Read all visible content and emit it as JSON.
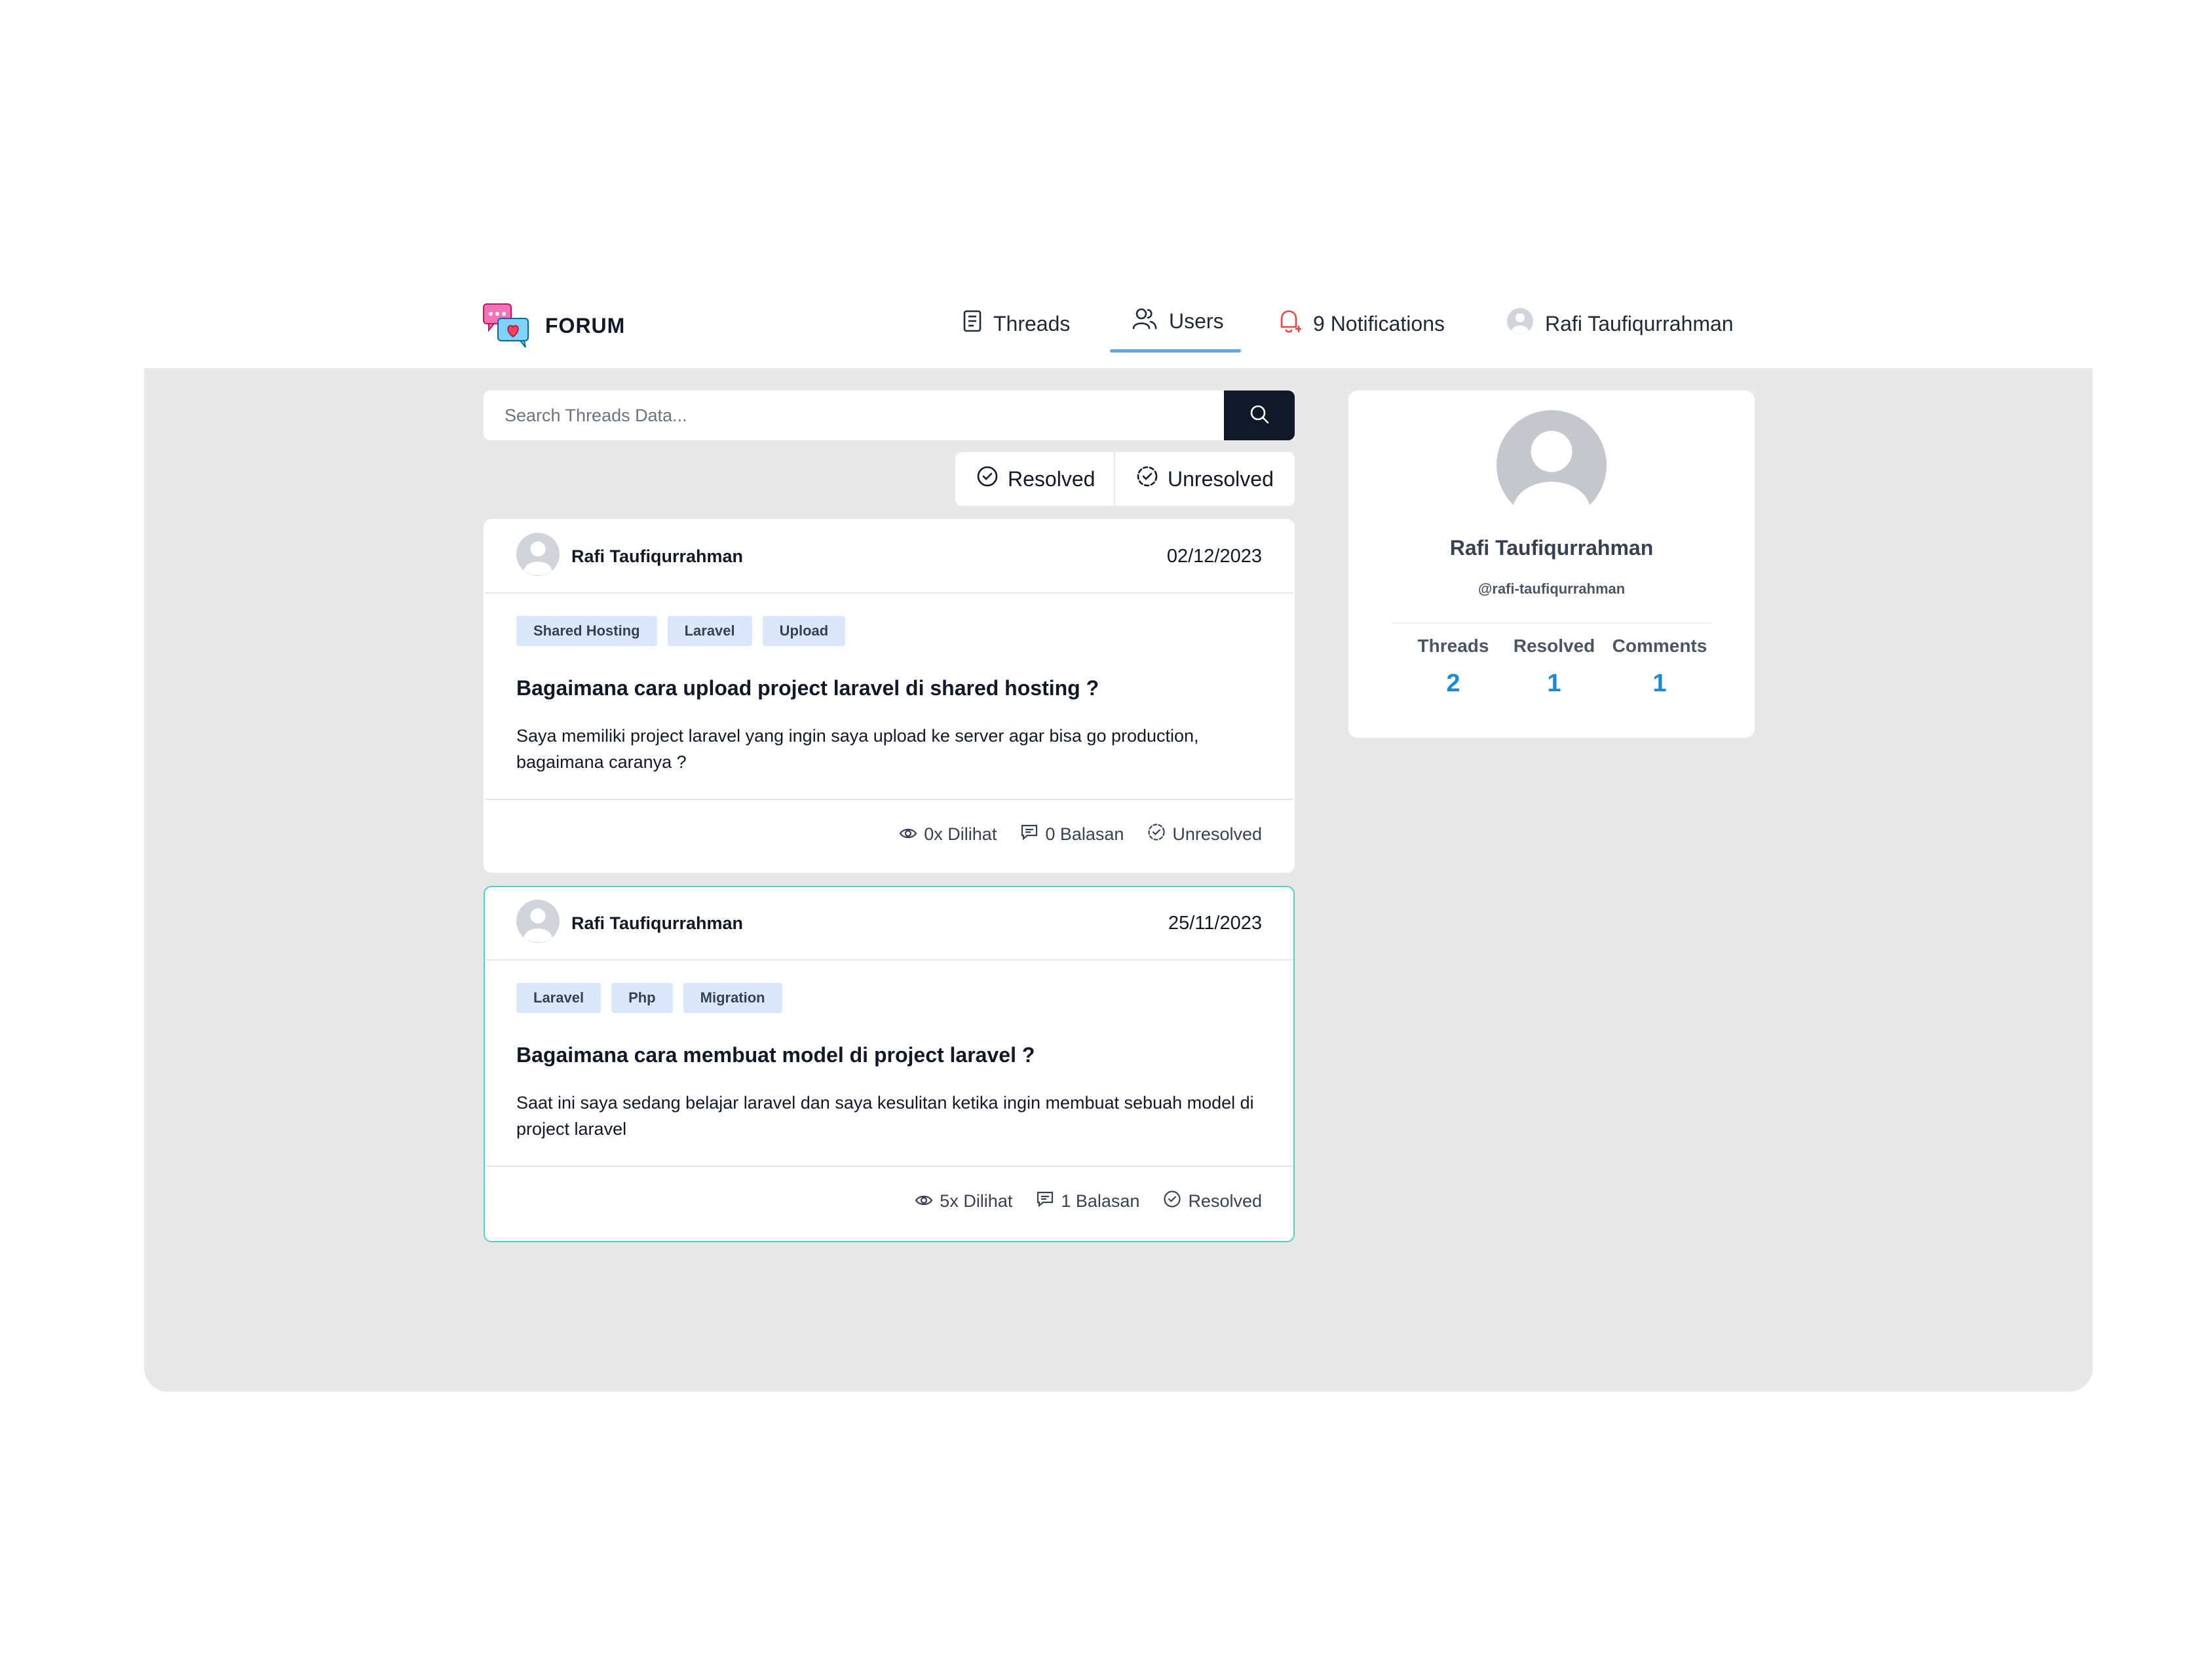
{
  "brand": {
    "name": "FORUM",
    "logo_icon": "chat-bubbles-heart-icon"
  },
  "nav": {
    "threads_label": "Threads",
    "users_label": "Users",
    "notifications_label": "9 Notifications",
    "user_label": "Rafi Taufiqurrahman",
    "active_tab": "Users"
  },
  "search": {
    "placeholder": "Search Threads Data..."
  },
  "filters": {
    "resolved_label": "Resolved",
    "unresolved_label": "Unresolved"
  },
  "threads": [
    {
      "author": "Rafi Taufiqurrahman",
      "date": "02/12/2023",
      "tags": [
        "Shared Hosting",
        "Laravel",
        "Upload"
      ],
      "title": "Bagaimana cara upload project laravel di shared hosting ?",
      "description": "Saya memiliki project laravel yang ingin saya upload ke server agar bisa go production, bagaimana caranya ?",
      "views": "0x Dilihat",
      "replies": "0 Balasan",
      "status": "Unresolved"
    },
    {
      "author": "Rafi Taufiqurrahman",
      "date": "25/11/2023",
      "tags": [
        "Laravel",
        "Php",
        "Migration"
      ],
      "title": "Bagaimana cara membuat model di project laravel ?",
      "description": "Saat ini saya sedang belajar laravel dan saya kesulitan ketika ingin membuat sebuah model di project laravel",
      "views": "5x Dilihat",
      "replies": "1 Balasan",
      "status": "Resolved"
    }
  ],
  "profile": {
    "name": "Rafi Taufiqurrahman",
    "handle": "@rafi-taufiqurrahman",
    "stats": {
      "threads_label": "Threads",
      "threads_value": "2",
      "resolved_label": "Resolved",
      "resolved_value": "1",
      "comments_label": "Comments",
      "comments_value": "1"
    }
  },
  "colors": {
    "accent_blue": "#1a8ad4",
    "tab_underline": "#60a5e8",
    "selected_card_border": "#4fd1c5",
    "tag_bg": "#dbe8fb",
    "search_button": "#111827",
    "notification_bell": "#ef4444"
  }
}
